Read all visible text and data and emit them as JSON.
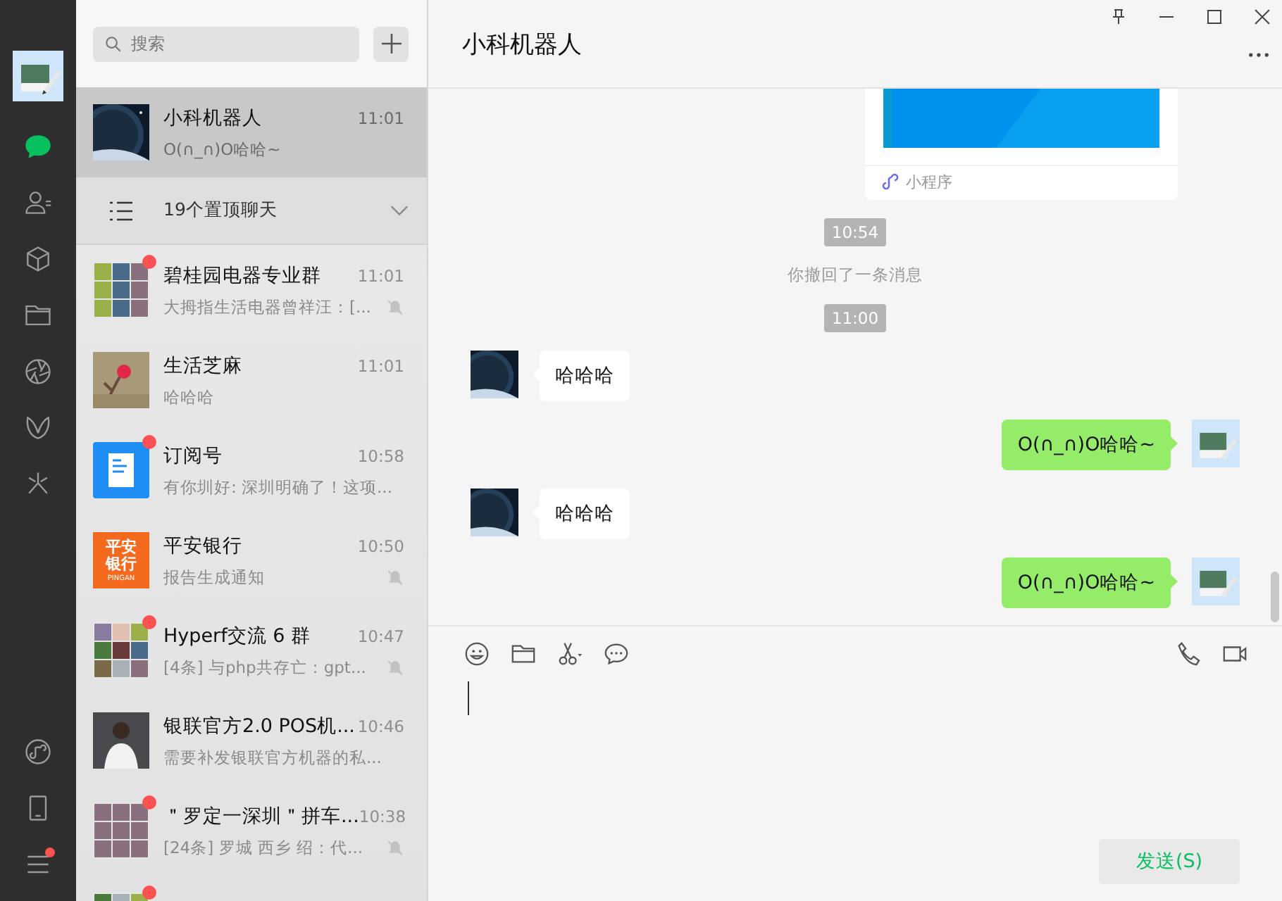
{
  "sidebar": {
    "items": [
      {
        "selected": true
      },
      {
        "selected": false
      },
      {
        "selected": false
      },
      {
        "selected": false
      },
      {
        "selected": false
      },
      {
        "selected": false
      },
      {
        "selected": false
      }
    ],
    "bottom_items": [
      {
        "unread": false
      },
      {
        "unread": false
      },
      {
        "unread": true
      }
    ]
  },
  "search": {
    "placeholder": "搜索"
  },
  "pinned_bar": {
    "label": "19个置顶聊天"
  },
  "chats": [
    {
      "kind": "planet",
      "name": "小科机器人",
      "time": "11:01",
      "preview": "O(∩_∩)O哈哈~",
      "unread": false,
      "muted": false,
      "selected": true
    },
    {
      "kind": "grid",
      "name": "碧桂园电器专业群",
      "time": "11:01",
      "preview": "大拇指生活电器曾祥汪：[...",
      "unread": true,
      "muted": true,
      "selected": false
    },
    {
      "kind": "flower",
      "name": "生活芝麻",
      "time": "11:01",
      "preview": "哈哈哈",
      "unread": false,
      "muted": false,
      "selected": false
    },
    {
      "kind": "doc",
      "name": "订阅号",
      "time": "10:58",
      "preview": "有你圳好: 深圳明确了！这项...",
      "unread": true,
      "muted": false,
      "selected": false
    },
    {
      "kind": "bank",
      "logo_lines": [
        "平安",
        "银行"
      ],
      "logo_caption": "PINGAN",
      "name": "平安银行",
      "time": "10:50",
      "preview": "报告生成通知",
      "unread": false,
      "muted": true,
      "selected": false
    },
    {
      "kind": "grid",
      "name": "Hyperf交流 6 群",
      "time": "10:47",
      "preview": "[4条] 与php共存亡：gpt...",
      "unread": true,
      "muted": true,
      "selected": false
    },
    {
      "kind": "person",
      "name": "银联官方2.0 POS机...",
      "time": "10:46",
      "preview": "需要补发银联官方机器的私...",
      "unread": false,
      "muted": false,
      "selected": false
    },
    {
      "kind": "grid",
      "name": "＂罗定一深圳＂拼车...",
      "time": "10:38",
      "preview": "[24条] 罗城 西乡 绍：代...",
      "unread": true,
      "muted": true,
      "selected": false
    },
    {
      "kind": "grid",
      "unread": true,
      "selected": false
    }
  ],
  "chat": {
    "title": "小科机器人",
    "messages": [
      {
        "kind": "card",
        "label": "小程序"
      },
      {
        "kind": "time",
        "text": "10:54"
      },
      {
        "kind": "system",
        "text": "你撤回了一条消息"
      },
      {
        "kind": "time",
        "text": "11:00"
      },
      {
        "kind": "received",
        "text": "哈哈哈"
      },
      {
        "kind": "sent",
        "text": "O(∩_∩)O哈哈~"
      },
      {
        "kind": "received",
        "text": "哈哈哈"
      },
      {
        "kind": "sent",
        "text": "O(∩_∩)O哈哈~"
      }
    ],
    "send_button": "发送(S)"
  }
}
